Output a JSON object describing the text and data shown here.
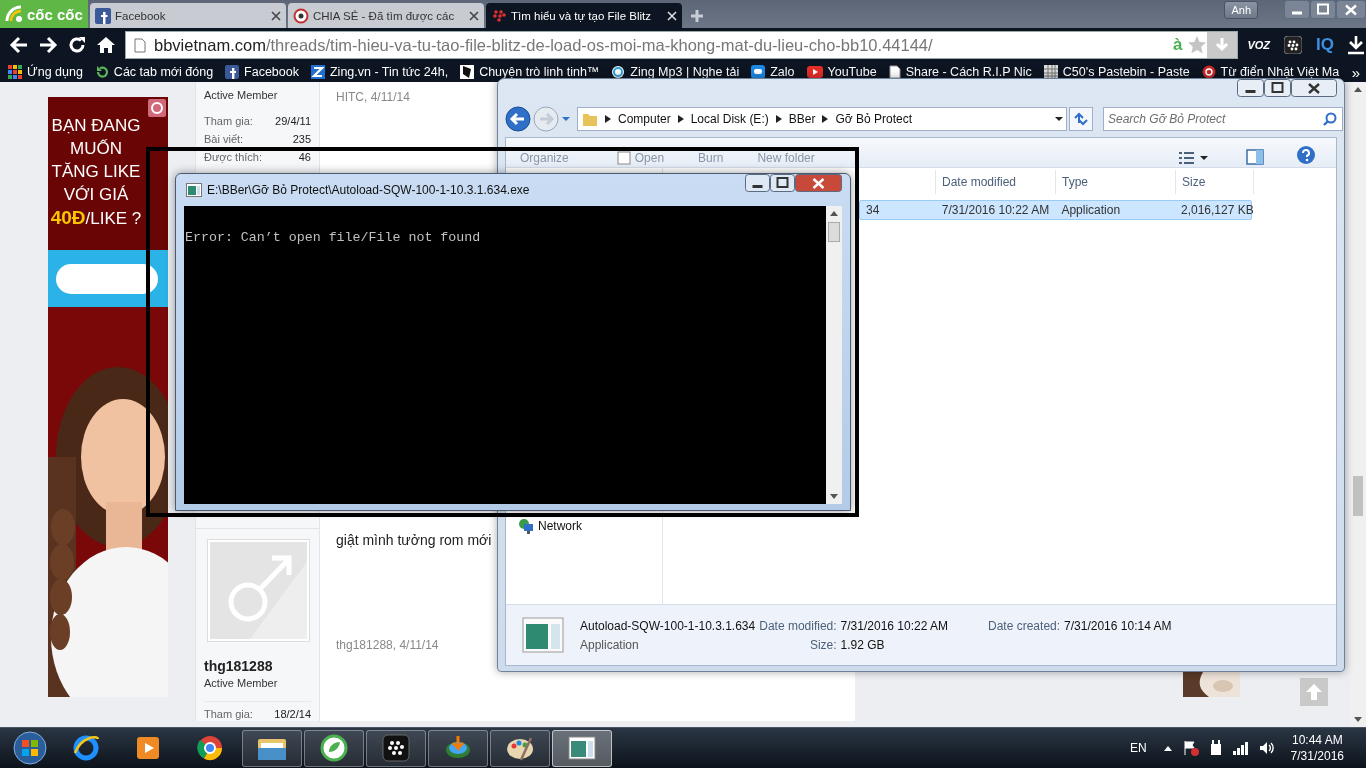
{
  "browser": {
    "menu_label": "cốc cốc",
    "tabs": [
      {
        "title": "Facebook",
        "selected": false
      },
      {
        "title": "CHIA SẺ - Đã tìm được các",
        "selected": false
      },
      {
        "title": "Tìm hiểu và tự tạo File Blitz",
        "selected": true
      }
    ],
    "profile": "Anh",
    "url": {
      "domain": "bbvietnam.com",
      "path": "/threads/tim-hieu-va-tu-tao-file-blitz-de-load-os-moi-ma-khong-mat-du-lieu-cho-bb10.44144/"
    },
    "omnibox_badge": "à",
    "extensions": [
      "VOZ",
      "IQ"
    ],
    "bookmarks": [
      "Ứng dụng",
      "Các tab mới đóng",
      "Facebook",
      "Zing.vn - Tin tức 24h,",
      "Chuyện trò linh tinh™",
      "Zing Mp3 | Nghe tải",
      "Zalo",
      "YouTube",
      "Share - Cách R.I.P Nic",
      "C50's Pastebin - Paste",
      "Từ điển Nhật Việt Ma"
    ],
    "bookmarks_overflow": "»"
  },
  "page": {
    "ad": {
      "headline": [
        "BẠN ĐANG",
        "MUỐN",
        "TĂNG LIKE",
        "VỚI GIÁ"
      ],
      "price": "40Đ",
      "price_unit": "/LIKE ?"
    },
    "posts": [
      {
        "avatar": false,
        "role": "Active Member",
        "stats": [
          {
            "label": "Tham gia:",
            "value": "29/4/11"
          },
          {
            "label": "Bài viết:",
            "value": "235"
          },
          {
            "label": "Được thích:",
            "value": "46"
          }
        ],
        "byline": "HITC, 4/11/14"
      },
      {
        "avatar": true,
        "username": "thg181288",
        "role": "Active Member",
        "stats": [
          {
            "label": "Tham gia:",
            "value": "18/2/14"
          }
        ],
        "message": "giật mình tưởng rom mới",
        "byline": "thg181288, 4/11/14"
      }
    ]
  },
  "explorer": {
    "breadcrumb": [
      "Computer",
      "Local Disk (E:)",
      "BBer",
      "Gỡ Bỏ Protect"
    ],
    "search_placeholder": "Search Gỡ Bỏ Protect",
    "toolbar": [
      "Organize",
      "Open",
      "Burn",
      "New folder"
    ],
    "columns": [
      "Date modified",
      "Type",
      "Size"
    ],
    "rows": [
      {
        "name": "34",
        "date_modified": "7/31/2016 10:22 AM",
        "type": "Application",
        "size": "2,016,127 KB",
        "selected": true
      }
    ],
    "nav": [
      "Network"
    ],
    "details": {
      "name": "Autoload-SQW-100-1-10.3.1.634",
      "type": "Application",
      "fields": [
        {
          "label": "Date modified:",
          "value": "7/31/2016 10:22 AM"
        },
        {
          "label": "Size:",
          "value": "1.92 GB"
        },
        {
          "label": "Date created:",
          "value": "7/31/2016 10:14 AM"
        }
      ]
    }
  },
  "console": {
    "title": "E:\\BBer\\Gỡ Bỏ Protect\\Autoload-SQW-100-1-10.3.1.634.exe",
    "lines": [
      "Error: Can’t open file/File not found"
    ]
  },
  "taskbar": {
    "items": [
      {
        "running": false,
        "active": false
      },
      {
        "running": false,
        "active": false
      },
      {
        "running": false,
        "active": false
      },
      {
        "running": true,
        "active": false
      },
      {
        "running": true,
        "active": false
      },
      {
        "running": true,
        "active": false
      },
      {
        "running": true,
        "active": false
      },
      {
        "running": true,
        "active": false
      },
      {
        "running": true,
        "active": true
      }
    ],
    "language": "EN",
    "time": "10:44 AM",
    "date": "7/31/2016"
  }
}
